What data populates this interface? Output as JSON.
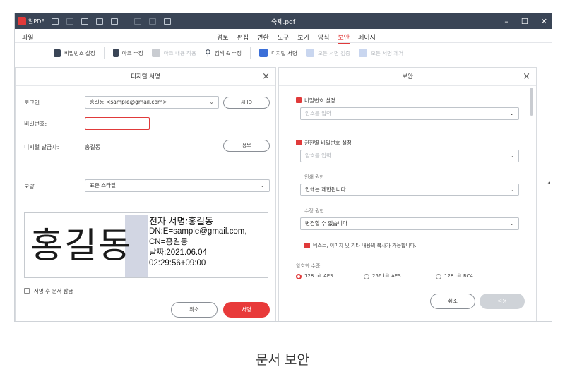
{
  "titlebar": {
    "app_name": "알PDF",
    "document_title": "숙제.pdf",
    "minimize": "–",
    "maximize": "☐",
    "close": "✕"
  },
  "menubar": {
    "file": "파일",
    "items": [
      "검토",
      "편집",
      "변환",
      "도구",
      "보기",
      "양식",
      "보안",
      "페이지"
    ],
    "active_item": "보안"
  },
  "ribbon": {
    "items": [
      {
        "label": "비밀번호 설정",
        "icon": "lock-icon",
        "color": "#3a4556",
        "enabled": true
      },
      {
        "label": "마크 수정",
        "icon": "markup-icon",
        "color": "#3a4556",
        "enabled": true
      },
      {
        "label": "마크 내용 적용",
        "icon": "check-icon",
        "color": "#b8bcc2",
        "enabled": false
      },
      {
        "label": "검색 & 수정",
        "icon": "search-icon",
        "color": "#3a4556",
        "enabled": true
      },
      {
        "label": "디지털 서명",
        "icon": "signature-icon",
        "color": "#3b6fd8",
        "enabled": true
      },
      {
        "label": "모든 서명 검증",
        "icon": "verify-icon",
        "color": "#b8bcc2",
        "enabled": false
      },
      {
        "label": "모든 서명 제거",
        "icon": "remove-signature-icon",
        "color": "#b8bcc2",
        "enabled": false
      }
    ]
  },
  "digital_signature_dialog": {
    "title": "디지털 서명",
    "login_label": "로그인:",
    "login_value": "홍길동 <sample@gmail.com>",
    "new_button": "새 ID",
    "password_label": "비밀번호:",
    "password_value": "",
    "issuer_label": "디지털 발급자:",
    "issuer_value": "홍길동",
    "info_button": "정보",
    "appearance_label": "모양:",
    "appearance_value": "표준 스타일",
    "signature_preview": {
      "name": "홍길동",
      "lines": [
        "전자 서명:홍길동",
        "DN:E=sample@gmail.com,",
        "CN=홍길동",
        "날짜:2021.06.04",
        "02:29:56+09:00"
      ]
    },
    "lock_after_sign_label": "서명 후 문서 잠금",
    "lock_after_sign_checked": false,
    "cancel_button": "취소",
    "sign_button": "서명"
  },
  "security_dialog": {
    "title": "보안",
    "open_password_label": "비밀번호 설정",
    "open_password_checked": true,
    "open_password_placeholder": "암호를 입력",
    "permission_password_label": "권한별 비밀번호 설정",
    "permission_password_checked": true,
    "permission_password_placeholder": "암호를 입력",
    "print_permission_label": "인쇄 권한",
    "print_permission_value": "인쇄는 제한됩니다",
    "edit_permission_label": "수정 권한",
    "edit_permission_value": "변경할 수 없습니다",
    "copy_allowed_label": "텍스트, 이미지 및 기타 내용의 복사가 가능합니다.",
    "copy_allowed_checked": true,
    "encryption_label": "암호화 수준",
    "encryption_options": [
      "128 bit AES",
      "256 bit AES",
      "128 bit RC4"
    ],
    "encryption_selected": "128 bit AES",
    "cancel_button": "취소",
    "ok_button": "적용"
  },
  "caption": "문서 보안",
  "colors": {
    "accent": "#e83a3a",
    "titlebar": "#3a4556"
  }
}
